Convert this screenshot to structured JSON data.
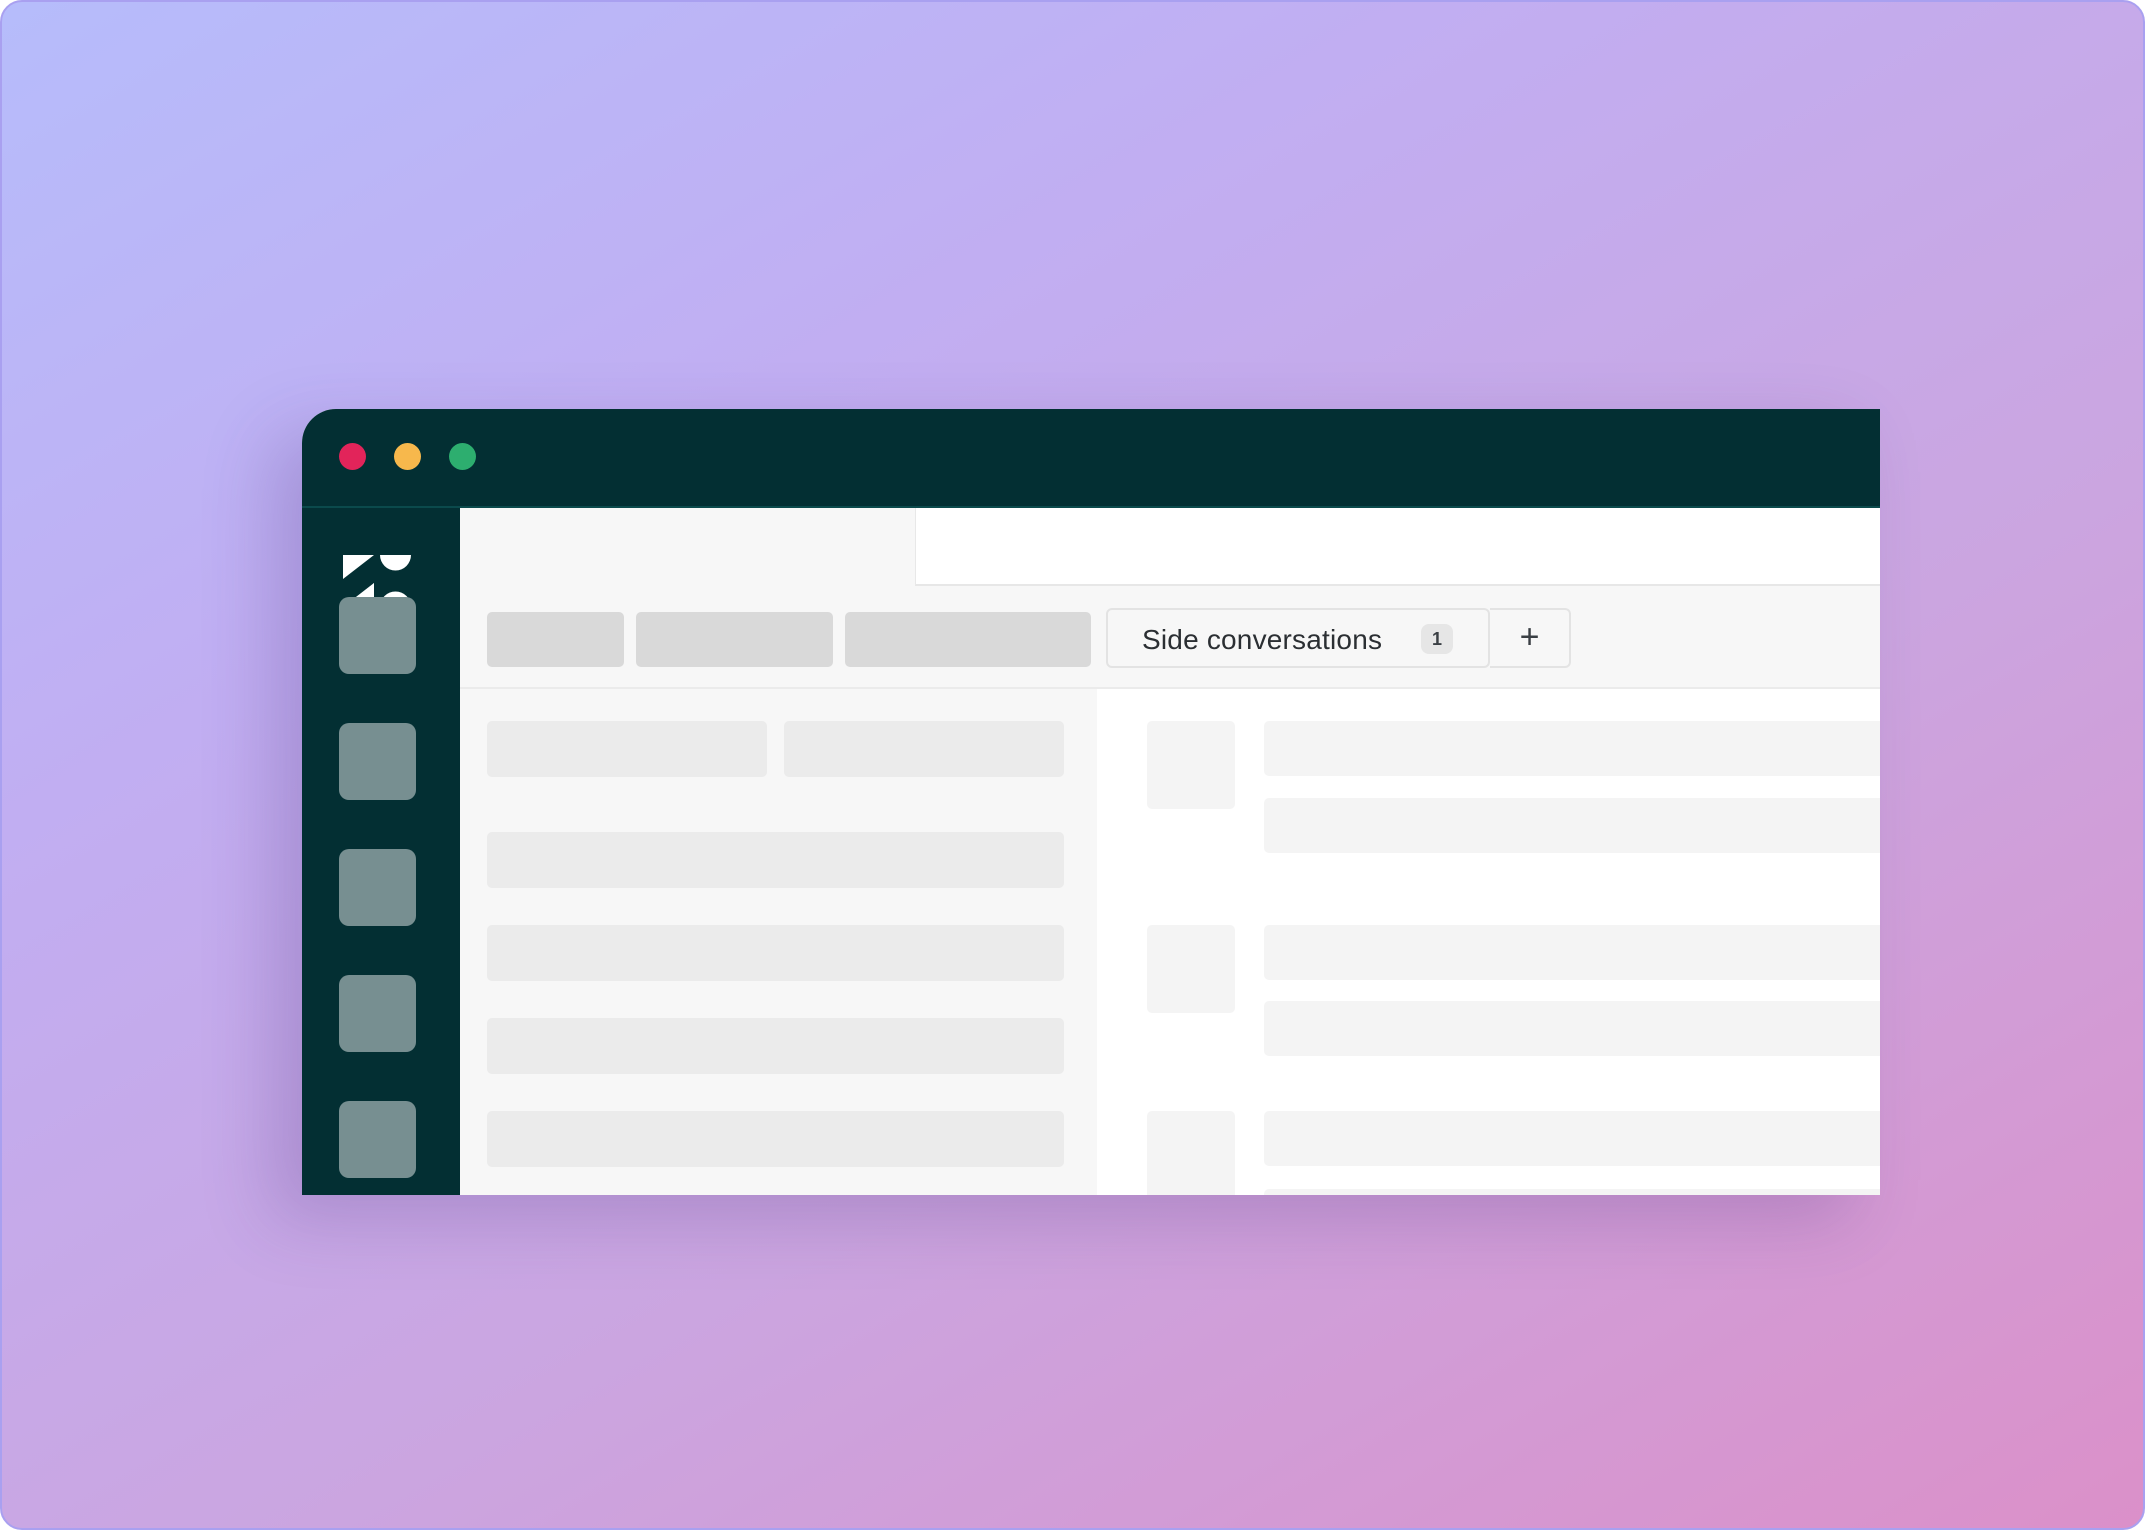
{
  "window": {
    "controls": [
      "close",
      "minimize",
      "maximize"
    ]
  },
  "sidebar": {
    "logo": "zendesk-logo",
    "nav_items": 5
  },
  "tabs": {
    "side_conversations": {
      "label": "Side conversations",
      "count": "1"
    },
    "add_label": "+"
  },
  "colors": {
    "titlebar": "#032f33",
    "sidebar": "#032f33",
    "nav_item": "#778f91",
    "close": "#e2245a",
    "minimize": "#f7b84c",
    "maximize": "#2dae6f"
  }
}
